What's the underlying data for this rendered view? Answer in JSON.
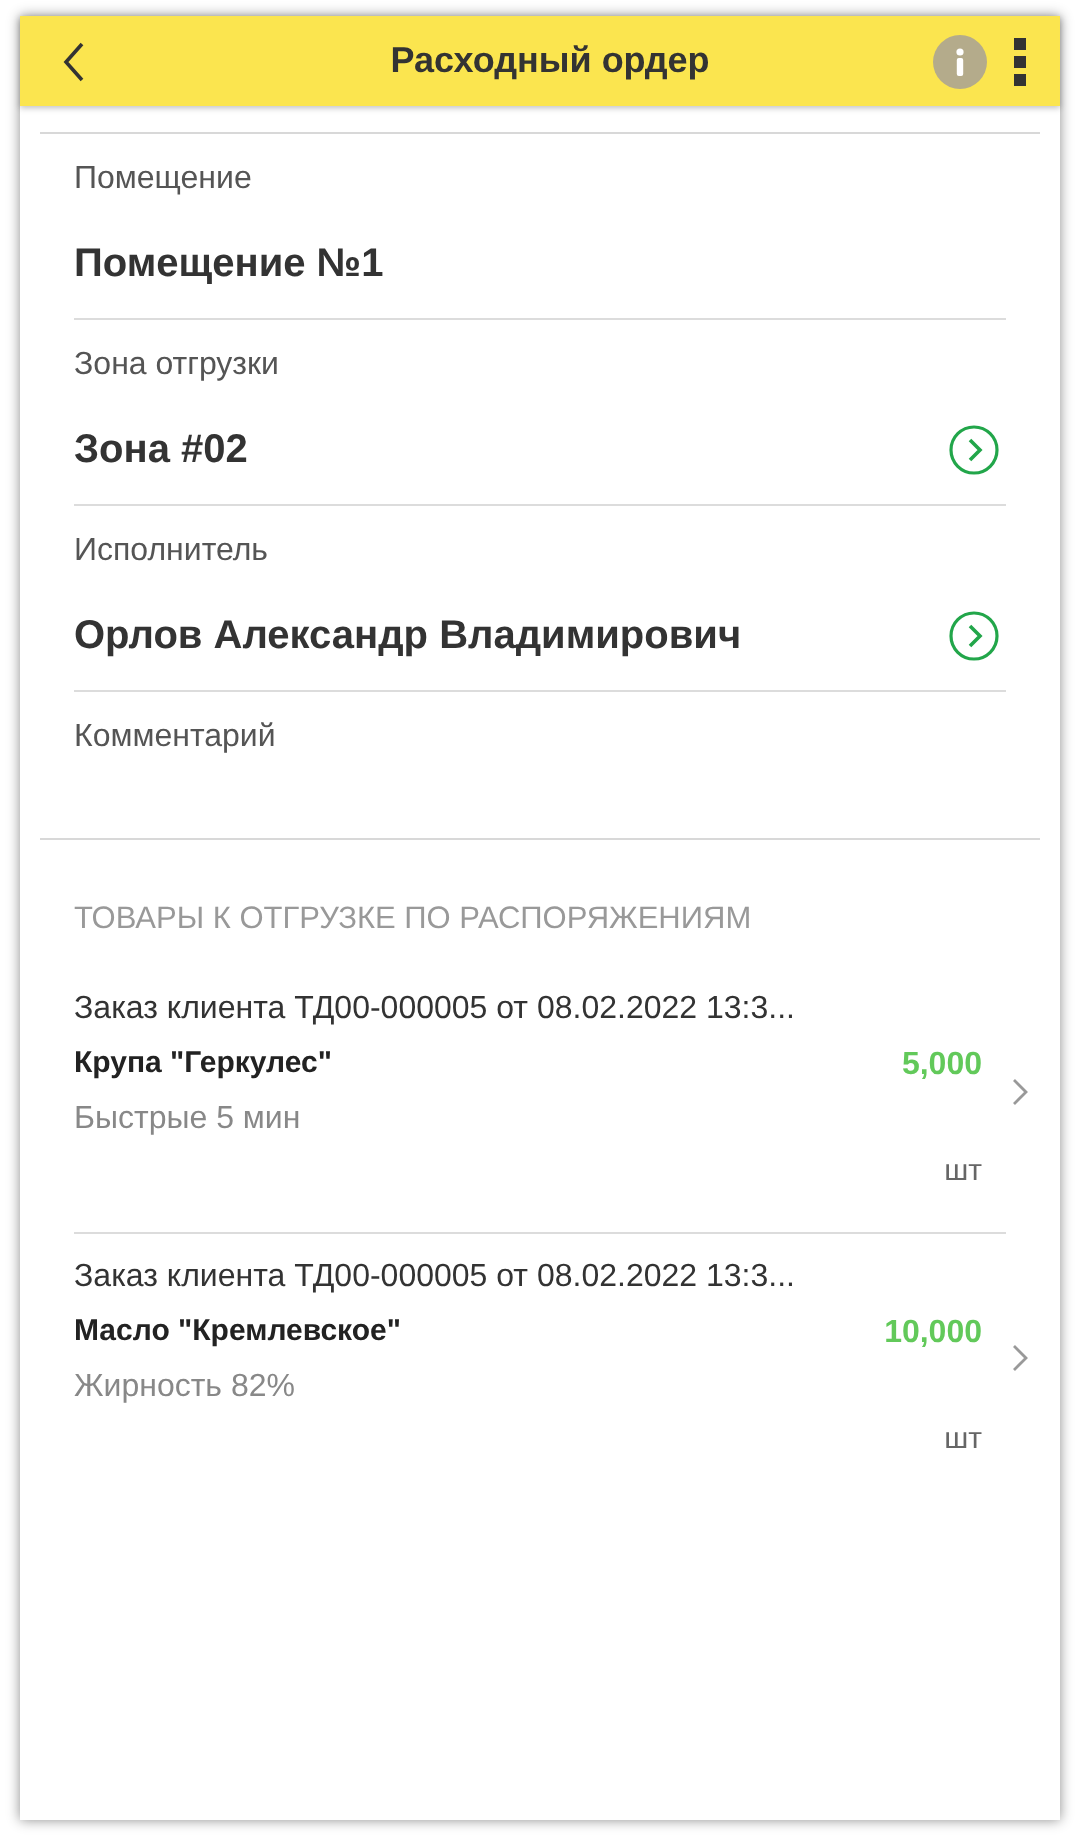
{
  "header": {
    "title": "Расходный ордер"
  },
  "fields": [
    {
      "label": "Помещение",
      "value": "Помещение №1",
      "navigable": false
    },
    {
      "label": "Зона отгрузки",
      "value": "Зона #02",
      "navigable": true
    },
    {
      "label": "Исполнитель",
      "value": "Орлов Александр Владимирович",
      "navigable": true
    },
    {
      "label": "Комментарий"
    }
  ],
  "section_title": "ТОВАРЫ К ОТГРУЗКЕ ПО РАСПОРЯЖЕНИЯМ",
  "items": [
    {
      "order": "Заказ клиента ТД00-000005 от 08.02.2022 13:3...",
      "product": "Крупа \"Геркулес\"",
      "note": "Быстрые 5 мин",
      "quantity": "5,000",
      "unit": "шт"
    },
    {
      "order": "Заказ клиента ТД00-000005 от 08.02.2022 13:3...",
      "product": "Масло \"Кремлевское\"",
      "note": "Жирность 82%",
      "quantity": "10,000",
      "unit": "шт"
    }
  ]
}
